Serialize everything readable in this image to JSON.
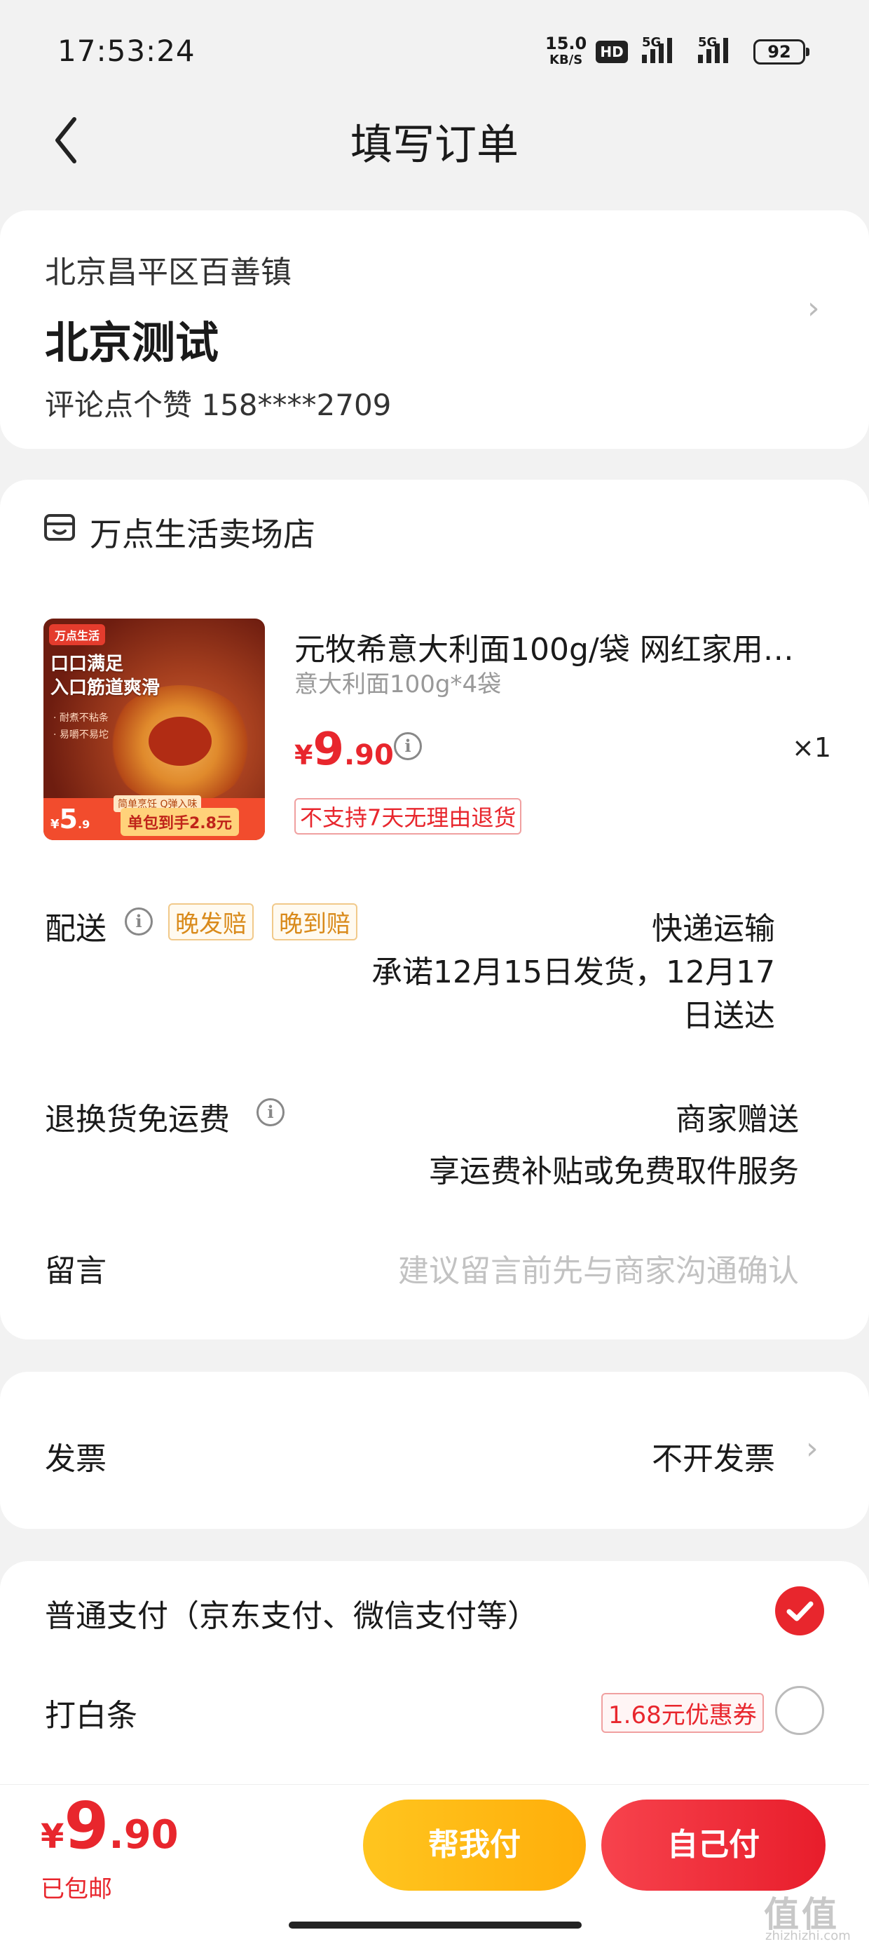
{
  "status_bar": {
    "time": "17:53:24",
    "net_speed_value": "15.0",
    "net_speed_unit": "KB/S",
    "hd_label": "HD",
    "sim1_label": "5G",
    "sim2_label": "5G",
    "battery": "92"
  },
  "header": {
    "title": "填写订单"
  },
  "address": {
    "region": "北京昌平区百善镇",
    "name": "北京测试",
    "contact": "评论点个赞  158****2709"
  },
  "store": {
    "name": "万点生活卖场店"
  },
  "product": {
    "image_brand": "万点生活",
    "image_slogan_1": "口口满足",
    "image_slogan_2": "入口筋道爽滑",
    "image_bullet_1": "· 耐煮不粘条",
    "image_bullet_2": "· 易嚼不易坨",
    "image_tag": "简单烹饪 Q弹入味",
    "image_price_int": "5",
    "image_price_dec": ".9",
    "image_promo": "单包到手2.8元",
    "title": "元牧希意大利面100g/袋 网红家用…",
    "spec": "意大利面100g*4袋",
    "price_currency": "¥",
    "price_int": "9",
    "price_dec": ".90",
    "quantity": "×1",
    "no_return_tag": "不支持7天无理由退货"
  },
  "delivery": {
    "label": "配送",
    "tag_late_ship": "晚发赔",
    "tag_late_arrive": "晚到赔",
    "method": "快递运输",
    "promise_line1": "承诺12月15日发货，12月17",
    "promise_line2": "日送达"
  },
  "return_shipping": {
    "label": "退换货免运费",
    "value_line1": "商家赠送",
    "value_line2": "享运费补贴或免费取件服务"
  },
  "message": {
    "label": "留言",
    "placeholder": "建议留言前先与商家沟通确认"
  },
  "invoice": {
    "label": "发票",
    "value": "不开发票"
  },
  "payment": {
    "normal_label": "普通支付（京东支付、微信支付等）",
    "baitiao_label": "打白条",
    "baitiao_coupon": "1.68元优惠券"
  },
  "footer": {
    "total_currency": "¥",
    "total_int": "9",
    "total_dec": ".90",
    "shipping_note": "已包邮",
    "help_pay_label": "帮我付",
    "self_pay_label": "自己付"
  },
  "watermark": {
    "text": "值值值",
    "url": "zhizhizhi.com"
  },
  "colors": {
    "accent": "#e8262d",
    "help_button": "#ffb80f",
    "background": "#f2f2f2"
  }
}
